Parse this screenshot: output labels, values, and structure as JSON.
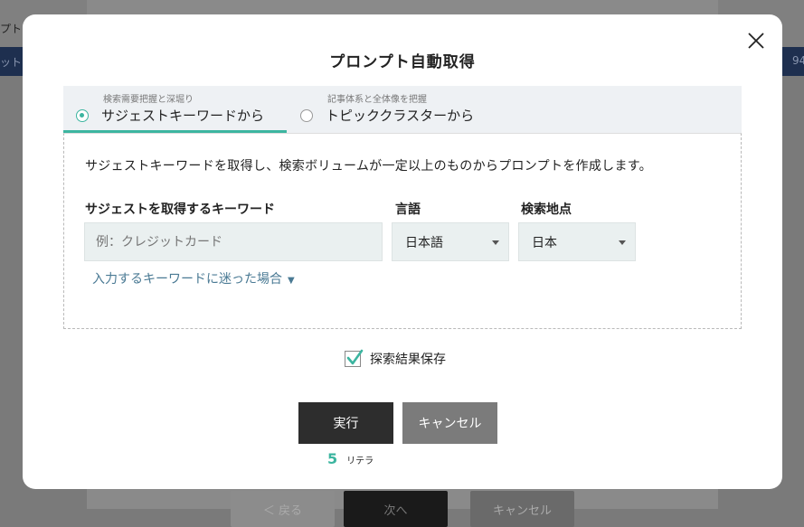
{
  "background": {
    "left_text": "プト",
    "bar_left_text": "ット",
    "bar_right_text": "94",
    "buttons": [
      "＜ 戻る",
      "次へ",
      "キャンセル"
    ]
  },
  "modal": {
    "title": "プロンプト自動取得",
    "tabs": [
      {
        "sublabel": "検索需要把握と深堀り",
        "label": "サジェストキーワードから",
        "selected": true
      },
      {
        "sublabel": "記事体系と全体像を把握",
        "label": "トピッククラスターから",
        "selected": false
      }
    ],
    "description": "サジェストキーワードを取得し、検索ボリュームが一定以上のものからプロンプトを作成します。",
    "keyword": {
      "label": "サジェストを取得するキーワード",
      "value": "",
      "placeholder": "例：クレジットカード"
    },
    "language": {
      "label": "言語",
      "selected": "日本語"
    },
    "location": {
      "label": "検索地点",
      "selected": "日本"
    },
    "hint": "入力するキーワードに迷った場合",
    "save_results": {
      "label": "探索結果保存",
      "checked": true
    },
    "run_label": "実行",
    "cancel_label": "キャンセル",
    "credits": {
      "amount": "5",
      "unit": "リテラ"
    }
  },
  "colors": {
    "accent": "#3cb5a0",
    "link": "#4a7a94",
    "run_button": "#2d2d2d",
    "cancel_button": "#7b7b7b"
  }
}
